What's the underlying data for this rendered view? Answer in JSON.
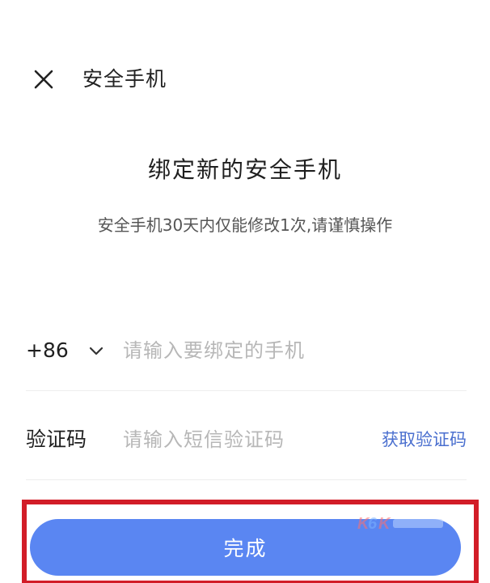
{
  "header": {
    "title": "安全手机"
  },
  "main": {
    "title": "绑定新的安全手机",
    "subtitle": "安全手机30天内仅能修改1次,请谨慎操作"
  },
  "form": {
    "country_code": "+86",
    "phone_placeholder": "请输入要绑定的手机",
    "phone_value": "",
    "code_label": "验证码",
    "code_placeholder": "请输入短信验证码",
    "code_value": "",
    "get_code_label": "获取验证码"
  },
  "actions": {
    "done_label": "完成"
  },
  "icons": {
    "close": "close-icon",
    "country_dropdown": "chevron-down-icon"
  },
  "colors": {
    "primary_button": "#5a86f2",
    "link": "#4a6fcf",
    "highlight_border": "#d21d28",
    "placeholder": "#b7b7b7"
  }
}
